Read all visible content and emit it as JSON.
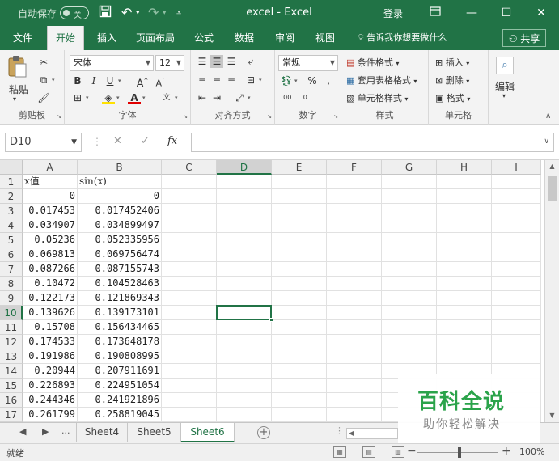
{
  "titlebar": {
    "autosave_label": "自动保存",
    "autosave_state": "关",
    "title": "excel  -  Excel",
    "login": "登录"
  },
  "tabs": [
    {
      "id": "file",
      "label": "文件"
    },
    {
      "id": "home",
      "label": "开始",
      "active": true
    },
    {
      "id": "insert",
      "label": "插入"
    },
    {
      "id": "page-layout",
      "label": "页面布局"
    },
    {
      "id": "formulas",
      "label": "公式"
    },
    {
      "id": "data",
      "label": "数据"
    },
    {
      "id": "review",
      "label": "审阅"
    },
    {
      "id": "view",
      "label": "视图"
    }
  ],
  "tell_me": "告诉我你想要做什么",
  "share": "共享",
  "ribbon": {
    "clipboard": {
      "label": "剪贴板",
      "paste": "粘贴"
    },
    "font": {
      "label": "字体",
      "name": "宋体",
      "size": "12"
    },
    "alignment": {
      "label": "对齐方式"
    },
    "number": {
      "label": "数字",
      "format": "常规"
    },
    "styles": {
      "label": "样式",
      "conditional": "条件格式",
      "table": "套用表格格式",
      "cell": "单元格样式"
    },
    "cells": {
      "label": "单元格",
      "insert": "插入",
      "delete": "删除",
      "format": "格式"
    },
    "editing": {
      "label": "编辑"
    }
  },
  "formula_bar": {
    "name_box": "D10",
    "value": ""
  },
  "grid": {
    "columns": [
      "A",
      "B",
      "C",
      "D",
      "E",
      "F",
      "G",
      "H",
      "I"
    ],
    "selected_col": "D",
    "selected_row": 10,
    "rows": [
      {
        "n": "1",
        "a": "x值",
        "b": "sin(x)"
      },
      {
        "n": "2",
        "a": "0",
        "b": "0"
      },
      {
        "n": "3",
        "a": "0.017453",
        "b": "0.017452406"
      },
      {
        "n": "4",
        "a": "0.034907",
        "b": "0.034899497"
      },
      {
        "n": "5",
        "a": "0.05236",
        "b": "0.052335956"
      },
      {
        "n": "6",
        "a": "0.069813",
        "b": "0.069756474"
      },
      {
        "n": "7",
        "a": "0.087266",
        "b": "0.087155743"
      },
      {
        "n": "8",
        "a": "0.10472",
        "b": "0.104528463"
      },
      {
        "n": "9",
        "a": "0.122173",
        "b": "0.121869343"
      },
      {
        "n": "10",
        "a": "0.139626",
        "b": "0.139173101"
      },
      {
        "n": "11",
        "a": "0.15708",
        "b": "0.156434465"
      },
      {
        "n": "12",
        "a": "0.174533",
        "b": "0.173648178"
      },
      {
        "n": "13",
        "a": "0.191986",
        "b": "0.190808995"
      },
      {
        "n": "14",
        "a": "0.20944",
        "b": "0.207911691"
      },
      {
        "n": "15",
        "a": "0.226893",
        "b": "0.224951054"
      },
      {
        "n": "16",
        "a": "0.244346",
        "b": "0.241921896"
      },
      {
        "n": "17",
        "a": "0.261799",
        "b": "0.258819045"
      }
    ]
  },
  "sheets": {
    "ellipsis": "...",
    "tabs": [
      {
        "label": "Sheet4"
      },
      {
        "label": "Sheet5"
      },
      {
        "label": "Sheet6",
        "active": true
      }
    ]
  },
  "status": {
    "ready": "就绪",
    "zoom": "100%"
  },
  "watermark": {
    "title": "百科全说",
    "subtitle": "助你轻松解决"
  },
  "colors": {
    "brand": "#217346",
    "watermark_green": "#2aa34a"
  }
}
